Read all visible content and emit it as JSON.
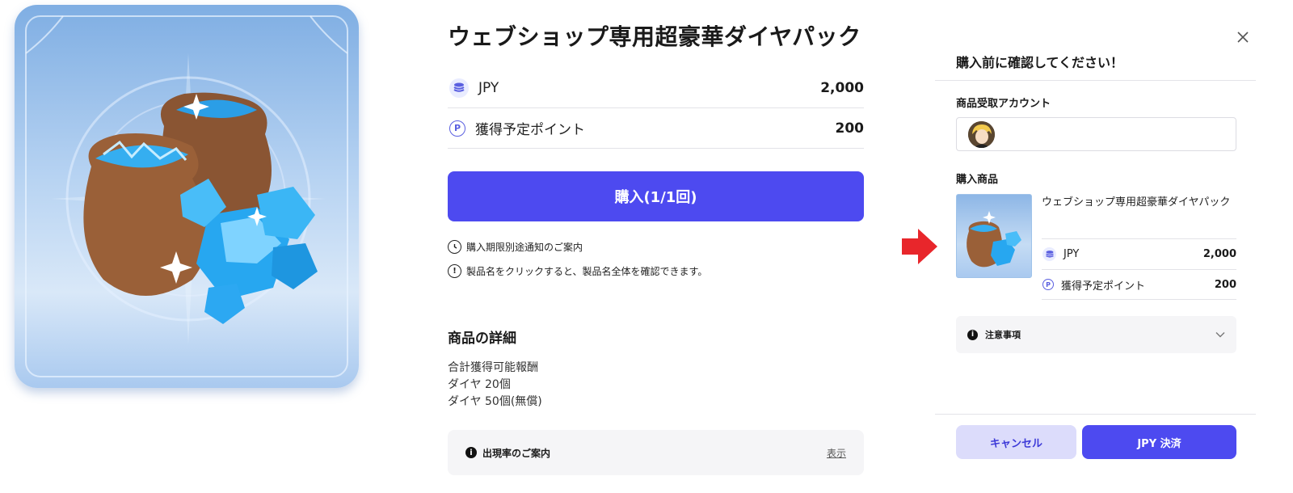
{
  "product": {
    "title": "ウェブショップ専用超豪華ダイヤパック",
    "image_icon": "diamond-bags-illustration",
    "prices": [
      {
        "icon": "coin-stack-icon",
        "label": "JPY",
        "value": "2,000"
      },
      {
        "icon": "point-p-icon",
        "label": "獲得予定ポイント",
        "value": "200"
      }
    ],
    "buy_label": "購入(1/1回)",
    "notices": [
      {
        "icon": "clock-icon",
        "text": "購入期限別途通知のご案内"
      },
      {
        "icon": "exclamation-icon",
        "text": "製品名をクリックすると、製品名全体を確認できます。"
      }
    ],
    "details": {
      "heading": "商品の詳細",
      "lines": [
        "合計獲得可能報酬",
        "ダイヤ 20個",
        "ダイヤ 50個(無償)"
      ]
    },
    "rate_box": {
      "label": "出現率のご案内",
      "link": "表示"
    }
  },
  "dialog": {
    "title": "購入前に確認してください！",
    "account_label": "商品受取アカウント",
    "item_label": "購入商品",
    "item_name": "ウェブショップ専用超豪華ダイヤパック",
    "prices": [
      {
        "label": "JPY",
        "value": "2,000"
      },
      {
        "label": "獲得予定ポイント",
        "value": "200"
      }
    ],
    "caution_label": "注意事項",
    "cancel_label": "キャンセル",
    "pay_label": "JPY 決済"
  },
  "colors": {
    "accent": "#4d4af0",
    "accent_light": "#dcdcfb",
    "arrow": "#e8262b",
    "divider": "#e3e3e8",
    "panel_bg": "#f5f5f7"
  }
}
